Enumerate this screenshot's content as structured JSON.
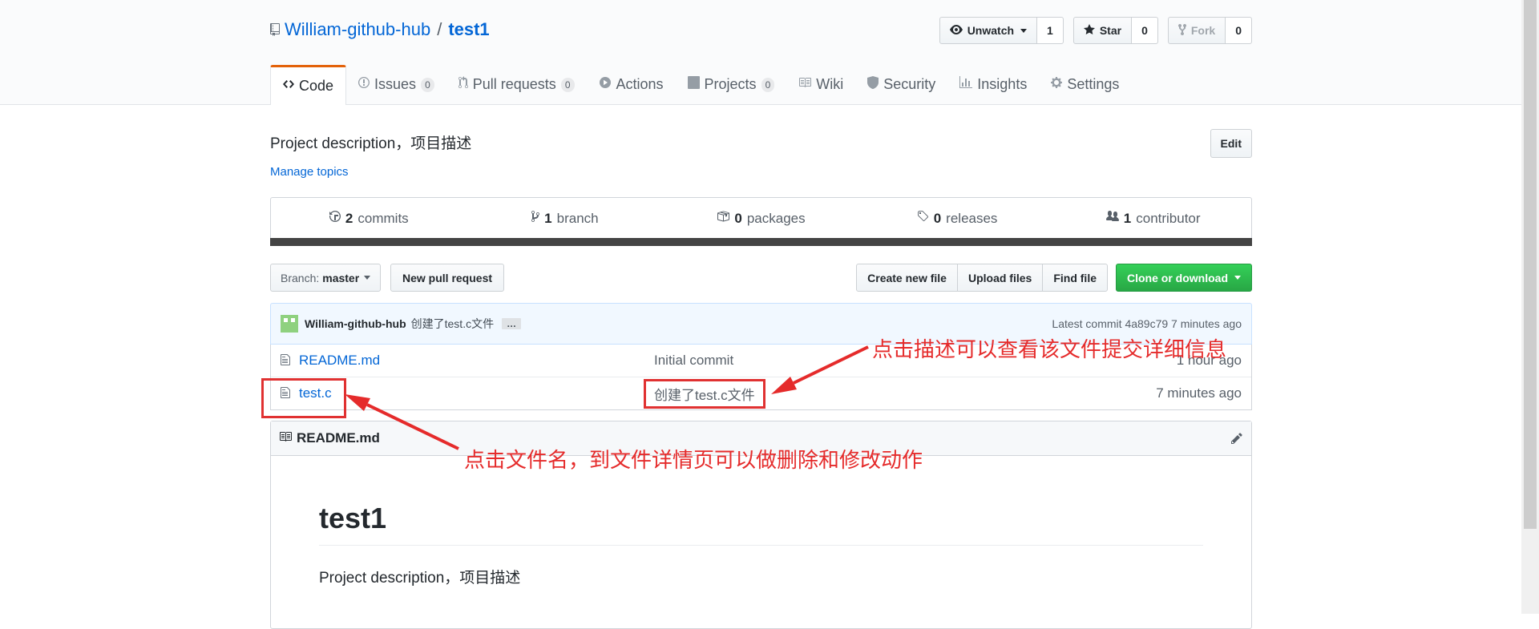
{
  "repo": {
    "owner": "William-github-hub",
    "separator": "/",
    "name": "test1"
  },
  "actions": {
    "unwatch_label": "Unwatch",
    "watch_count": "1",
    "star_label": "Star",
    "star_count": "0",
    "fork_label": "Fork",
    "fork_count": "0"
  },
  "tabs": [
    {
      "label": "Code",
      "icon": "code-icon"
    },
    {
      "label": "Issues",
      "count": "0",
      "icon": "issue-icon"
    },
    {
      "label": "Pull requests",
      "count": "0",
      "icon": "pull-request-icon"
    },
    {
      "label": "Actions",
      "icon": "play-icon"
    },
    {
      "label": "Projects",
      "count": "0",
      "icon": "project-icon"
    },
    {
      "label": "Wiki",
      "icon": "book-icon"
    },
    {
      "label": "Security",
      "icon": "shield-icon"
    },
    {
      "label": "Insights",
      "icon": "graph-icon"
    },
    {
      "label": "Settings",
      "icon": "gear-icon"
    }
  ],
  "about": {
    "description": "Project description，项目描述",
    "manage_topics": "Manage topics",
    "edit_label": "Edit"
  },
  "summary": {
    "commits_num": "2",
    "commits_label": "commits",
    "branch_num": "1",
    "branch_label": "branch",
    "packages_num": "0",
    "packages_label": "packages",
    "releases_num": "0",
    "releases_label": "releases",
    "contributors_num": "1",
    "contributors_label": "contributor",
    "language_bar_color": "#444444"
  },
  "file_nav": {
    "branch_prefix": "Branch:",
    "branch_name": "master",
    "new_pull_request": "New pull request",
    "create_new_file": "Create new file",
    "upload_files": "Upload files",
    "find_file": "Find file",
    "clone_or_download": "Clone or download"
  },
  "commit": {
    "author": "William-github-hub",
    "message": "创建了test.c文件",
    "ellipsis": "…",
    "latest_label": "Latest commit",
    "sha": "4a89c79",
    "age": "7 minutes ago"
  },
  "files": [
    {
      "name": "README.md",
      "message": "Initial commit",
      "age": "1 hour ago"
    },
    {
      "name": "test.c",
      "message": "创建了test.c文件",
      "age": "7 minutes ago"
    }
  ],
  "readme": {
    "filename": "README.md",
    "heading": "test1",
    "body": "Project description，项目描述"
  },
  "annotations": {
    "top_note": "点击描述可以查看该文件提交详细信息",
    "bottom_note": "点击文件名，到文件详情页可以做删除和修改动作",
    "color": "#e52b2b"
  },
  "colors": {
    "link": "#0366d6",
    "selected_tab_accent": "#e36209",
    "clone_button": "#28a745"
  }
}
